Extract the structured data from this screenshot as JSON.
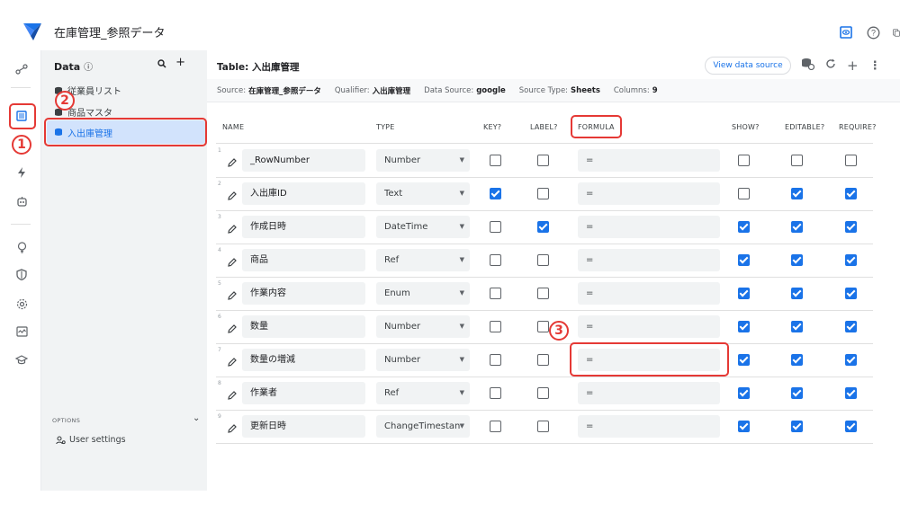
{
  "app": {
    "title": "在庫管理_参照データ"
  },
  "colors": {
    "accent": "#1a73e8",
    "annotation": "#e53935",
    "logo": "#1a73e8"
  },
  "top_icons": [
    "preview-icon",
    "help-icon",
    "copy-icon"
  ],
  "rail": {
    "icons": [
      "connections-icon",
      "data-icon",
      "automation-icon",
      "app-icon",
      "insights-icon",
      "security-icon",
      "settings-icon",
      "monitor-icon",
      "learn-icon"
    ]
  },
  "data_panel": {
    "title": "Data",
    "info_icon": "info-icon",
    "items": [
      {
        "label": "従業員リスト",
        "selected": false
      },
      {
        "label": "商品マスタ",
        "selected": false
      },
      {
        "label": "入出庫管理",
        "selected": true
      }
    ],
    "options_label": "OPTIONS",
    "user_settings": "User settings"
  },
  "table": {
    "title": "Table: 入出庫管理",
    "view_data_source": "View data source",
    "source_label": "Source:",
    "source_value": "在庫管理_参照データ",
    "qualifier_label": "Qualifier:",
    "qualifier_value": "入出庫管理",
    "data_source_label": "Data Source:",
    "data_source_value": "google",
    "source_type_label": "Source Type:",
    "source_type_value": "Sheets",
    "columns_label": "Columns:",
    "columns_value": "9"
  },
  "headers": {
    "name": "NAME",
    "type": "TYPE",
    "key": "KEY?",
    "label": "LABEL?",
    "formula": "FORMULA",
    "show": "SHOW?",
    "editable": "EDITABLE?",
    "require": "REQUIRE?"
  },
  "rows": [
    {
      "num": "1",
      "name": "_RowNumber",
      "type": "Number",
      "key": false,
      "label": false,
      "formula": "=",
      "show": false,
      "editable": false,
      "require": false
    },
    {
      "num": "2",
      "name": "入出庫ID",
      "type": "Text",
      "key": true,
      "label": false,
      "formula": "=",
      "show": false,
      "editable": true,
      "require": true
    },
    {
      "num": "3",
      "name": "作成日時",
      "type": "DateTime",
      "key": false,
      "label": true,
      "formula": "=",
      "show": true,
      "editable": true,
      "require": true
    },
    {
      "num": "4",
      "name": "商品",
      "type": "Ref",
      "key": false,
      "label": false,
      "formula": "=",
      "show": true,
      "editable": true,
      "require": true
    },
    {
      "num": "5",
      "name": "作業内容",
      "type": "Enum",
      "key": false,
      "label": false,
      "formula": "=",
      "show": true,
      "editable": true,
      "require": true
    },
    {
      "num": "6",
      "name": "数量",
      "type": "Number",
      "key": false,
      "label": false,
      "formula": "=",
      "show": true,
      "editable": true,
      "require": true
    },
    {
      "num": "7",
      "name": "数量の増減",
      "type": "Number",
      "key": false,
      "label": false,
      "formula": "=",
      "show": true,
      "editable": true,
      "require": true
    },
    {
      "num": "8",
      "name": "作業者",
      "type": "Ref",
      "key": false,
      "label": false,
      "formula": "=",
      "show": true,
      "editable": true,
      "require": true
    },
    {
      "num": "9",
      "name": "更新日時",
      "type": "ChangeTimestan",
      "key": false,
      "label": false,
      "formula": "=",
      "show": true,
      "editable": true,
      "require": true
    }
  ],
  "annotations": {
    "one": "1",
    "two": "2",
    "three": "3"
  }
}
